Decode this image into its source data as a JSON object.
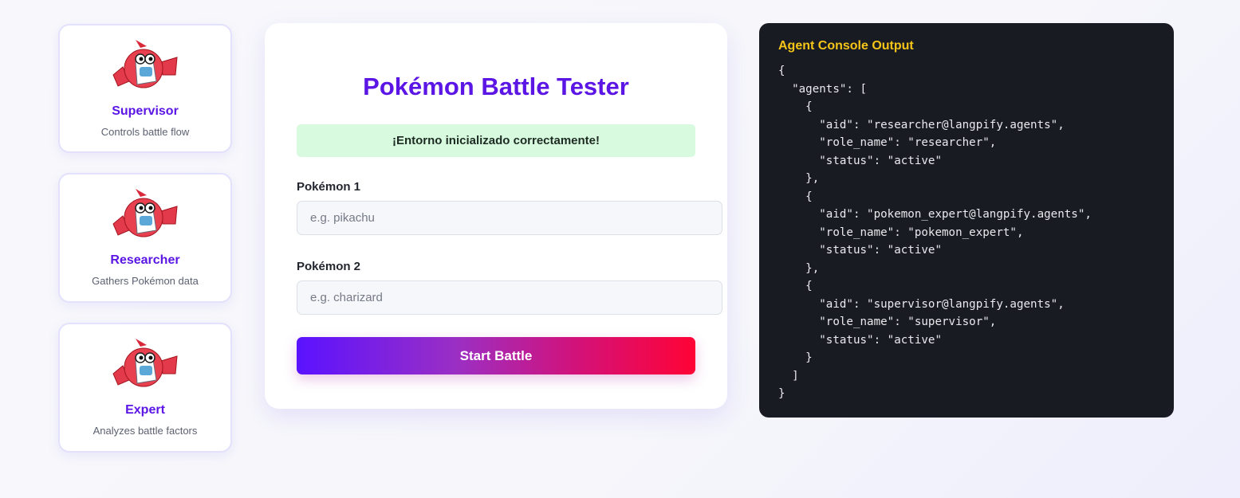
{
  "agents": [
    {
      "name": "Supervisor",
      "description": "Controls battle flow",
      "icon": "rotom-dex-icon"
    },
    {
      "name": "Researcher",
      "description": "Gathers Pokémon data",
      "icon": "rotom-dex-icon"
    },
    {
      "name": "Expert",
      "description": "Analyzes battle factors",
      "icon": "rotom-dex-icon"
    }
  ],
  "main": {
    "title": "Pokémon Battle Tester",
    "status_message": "¡Entorno inicializado correctamente!",
    "pokemon1": {
      "label": "Pokémon 1",
      "value": "",
      "placeholder": "e.g. pikachu"
    },
    "pokemon2": {
      "label": "Pokémon 2",
      "value": "",
      "placeholder": "e.g. charizard"
    },
    "start_button_label": "Start Battle"
  },
  "console": {
    "title": "Agent Console Output",
    "output": "{\n  \"agents\": [\n    {\n      \"aid\": \"researcher@langpify.agents\",\n      \"role_name\": \"researcher\",\n      \"status\": \"active\"\n    },\n    {\n      \"aid\": \"pokemon_expert@langpify.agents\",\n      \"role_name\": \"pokemon_expert\",\n      \"status\": \"active\"\n    },\n    {\n      \"aid\": \"supervisor@langpify.agents\",\n      \"role_name\": \"supervisor\",\n      \"status\": \"active\"\n    }\n  ]\n}"
  },
  "colors": {
    "accent": "#5b16e6",
    "console_title": "#f5c518",
    "success_bg": "#d8fbe0",
    "console_bg": "#191b23",
    "button_gradient_start": "#5a12ff",
    "button_gradient_end": "#ff0336"
  }
}
